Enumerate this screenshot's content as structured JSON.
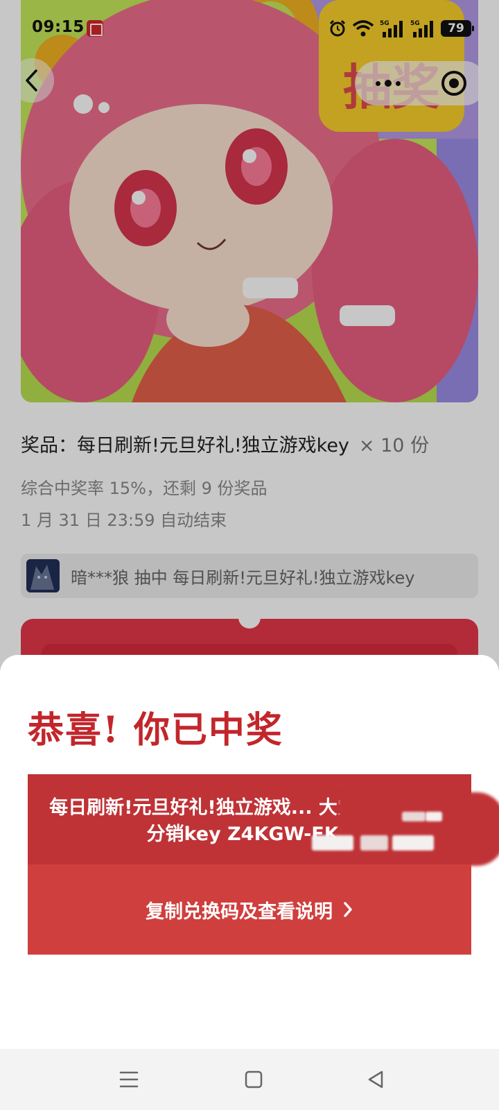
{
  "status_bar": {
    "time": "09:15",
    "battery": "79",
    "network_1": "5G",
    "network_2": "5G"
  },
  "header": {
    "back_icon": "chevron-left-icon",
    "more_icon": "more-dots-icon",
    "close_icon": "target-close-icon"
  },
  "prize_info": {
    "prize_label": "奖品：每日刷新!元旦好礼!独立游戏key",
    "quantity": "× 10 份",
    "rate": "综合中奖率 15%，还剩 9 份奖品",
    "end_time": "1 月 31 日 23:59 自动结束"
  },
  "winner_bar": {
    "text": "暗***狼 抽中 每日刷新!元旦好礼!独立游戏key"
  },
  "modal": {
    "title": "恭喜! 你已中奖",
    "prize_code_text": "每日刷新!元旦好礼!独立游戏... 大宝贝回收公司 分销key Z4KGW-FKP",
    "copy_button": "复制兑换码及查看说明",
    "accent_color": "#c2262b"
  },
  "nav_bar": {
    "menu_icon": "menu-icon",
    "home_icon": "home-square-icon",
    "back_icon": "back-triangle-icon"
  }
}
